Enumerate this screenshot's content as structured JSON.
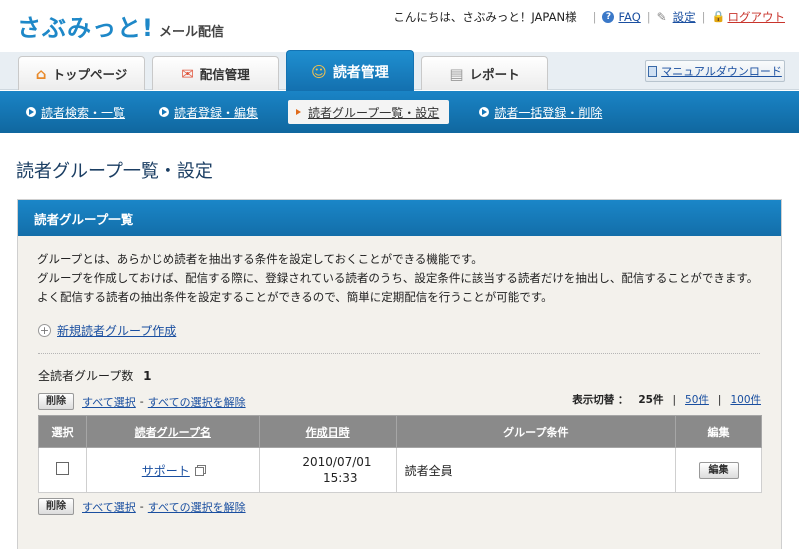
{
  "header": {
    "logo_main": "さぶみっと!",
    "logo_sub": "メール配信",
    "greeting": "こんにちは、さぶみっと！JAPAN様",
    "faq": "FAQ",
    "settings": "設定",
    "logout": "ログアウト"
  },
  "tabs": [
    {
      "label": "トップページ",
      "icon": "home-icon"
    },
    {
      "label": "配信管理",
      "icon": "mail-icon"
    },
    {
      "label": "読者管理",
      "icon": "users-icon"
    },
    {
      "label": "レポート",
      "icon": "report-icon"
    }
  ],
  "manual_download": "マニュアルダウンロード",
  "subnav": [
    {
      "label": "読者検索・一覧"
    },
    {
      "label": "読者登録・編集"
    },
    {
      "label": "読者グループ一覧・設定"
    },
    {
      "label": "読者一括登録・削除"
    }
  ],
  "page_title": "読者グループ一覧・設定",
  "panel": {
    "title": "読者グループ一覧",
    "desc": [
      "グループとは、あらかじめ読者を抽出する条件を設定しておくことができる機能です。",
      "グループを作成しておけば、配信する際に、登録されている読者のうち、設定条件に該当する読者だけを抽出し、配信することができます。",
      "よく配信する読者の抽出条件を設定することができるので、簡単に定期配信を行うことが可能です。"
    ],
    "new_group": "新規読者グループ作成",
    "total_label": "全読者グループ数",
    "total_count": "1",
    "delete_btn": "削除",
    "select_all": "すべて選択",
    "dash": "-",
    "deselect_all": "すべての選択を解除",
    "perpage_label": "表示切替 ：",
    "perpage_current": "25件",
    "perpage_pipe": "|",
    "perpage_50": "50件",
    "perpage_100": "100件"
  },
  "table": {
    "headers": {
      "select": "選択",
      "name": "読者グループ名",
      "created": "作成日時",
      "condition": "グループ条件",
      "edit": "編集"
    },
    "rows": [
      {
        "name": "サポート",
        "date": "2010/07/01",
        "time": "15:33",
        "condition": "読者全員",
        "edit": "編集"
      }
    ]
  },
  "colors": {
    "brand_blue": "#1677b8",
    "logout_red": "#c8342c",
    "link_blue": "#1a4fa0"
  }
}
